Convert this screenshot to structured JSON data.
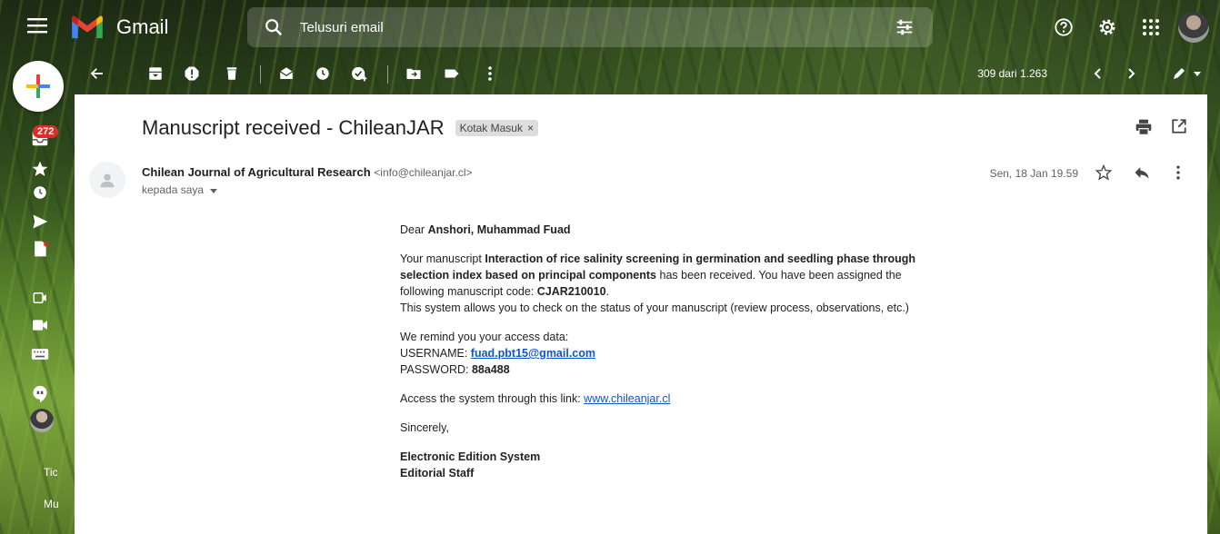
{
  "app": {
    "name": "Gmail",
    "colors": {
      "m_red": "#EA4335",
      "m_blue": "#4285F4",
      "m_green": "#34A853",
      "m_yellow": "#FBBC04",
      "badge": "#d93025",
      "link": "#1155cc"
    }
  },
  "search": {
    "placeholder": "Telusuri email"
  },
  "toolbar": {
    "icons": [
      "back-arrow-icon",
      "archive-icon",
      "report-spam-icon",
      "delete-icon",
      "mark-unread-icon",
      "snooze-icon",
      "add-to-tasks-icon",
      "move-to-icon",
      "label-icon",
      "more-vert-icon"
    ],
    "pager_text": "309 dari 1.263"
  },
  "rail": {
    "inbox_badge": "272",
    "labels": [
      "Tic",
      "Mu"
    ]
  },
  "email": {
    "subject": "Manuscript received - ChileanJAR",
    "label_chip": "Kotak Masuk",
    "sender_name": "Chilean Journal of Agricultural Research",
    "sender_email": "<info@chileanjar.cl>",
    "to_line": "kepada saya",
    "date": "Sen, 18 Jan 19.59",
    "body": {
      "greeting_prefix": "Dear ",
      "recipient": "Anshori, Muhammad Fuad",
      "p1_prefix": "Your manuscript ",
      "title": "Interaction of rice salinity screening in germination and seedling phase through selection index based on principal components",
      "p1_mid": " has been received. You have been assigned the following manuscript code: ",
      "code": "CJAR210010",
      "p1_end": ".",
      "p1_line2": "This system allows you to check on the status of your manuscript (review process, observations, etc.)",
      "remind": "We remind you your access data:",
      "username_label": "USERNAME: ",
      "username": "fuad.pbt15@gmail.com",
      "password_label": "PASSWORD: ",
      "password": "88a488",
      "access_prefix": "Access the system through this link: ",
      "access_link": "www.chileanjar.cl",
      "closing": "Sincerely,",
      "sig1": "Electronic Edition System",
      "sig2": "Editorial Staff"
    }
  }
}
